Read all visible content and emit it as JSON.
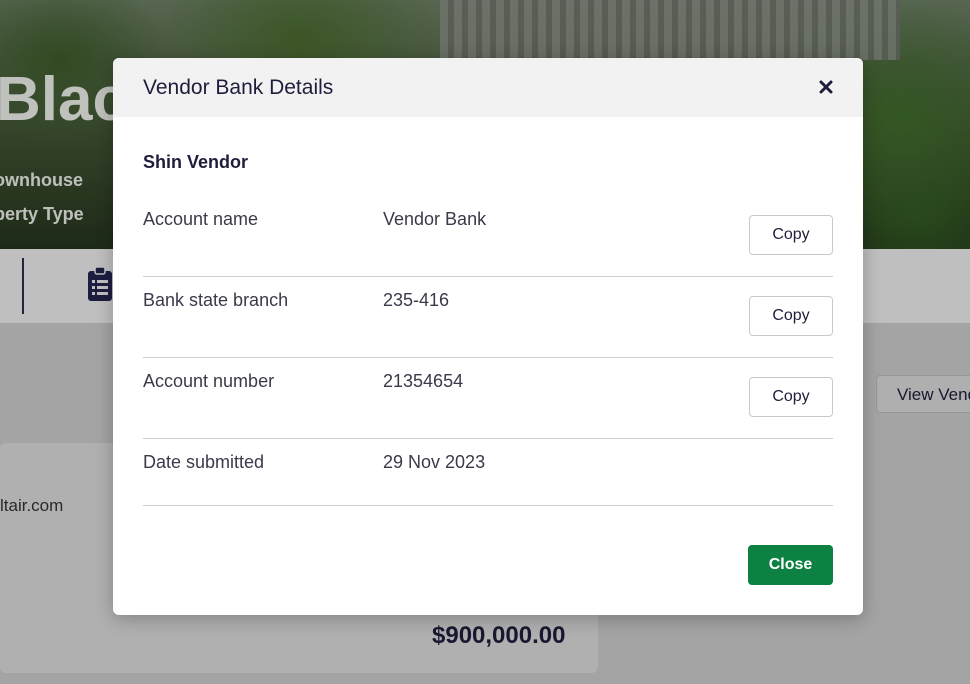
{
  "background": {
    "hero_title": "Blac",
    "hero_subtitle_1": "ownhouse",
    "hero_subtitle_2": "perty Type",
    "email_snippet": "ltair.com",
    "price": "$900,000.00",
    "view_vendor_label": "View Vend"
  },
  "modal": {
    "title": "Vendor Bank Details",
    "close_icon": "close-icon",
    "vendor_name": "Shin Vendor",
    "rows": [
      {
        "label": "Account name",
        "value": "Vendor Bank",
        "copy_label": "Copy"
      },
      {
        "label": "Bank state branch",
        "value": "235-416",
        "copy_label": "Copy"
      },
      {
        "label": "Account number",
        "value": "21354654",
        "copy_label": "Copy"
      },
      {
        "label": "Date submitted",
        "value": "29 Nov 2023"
      }
    ],
    "close_label": "Close"
  },
  "colors": {
    "primary_button": "#0d8142",
    "text_dark": "#1e1e3c"
  }
}
